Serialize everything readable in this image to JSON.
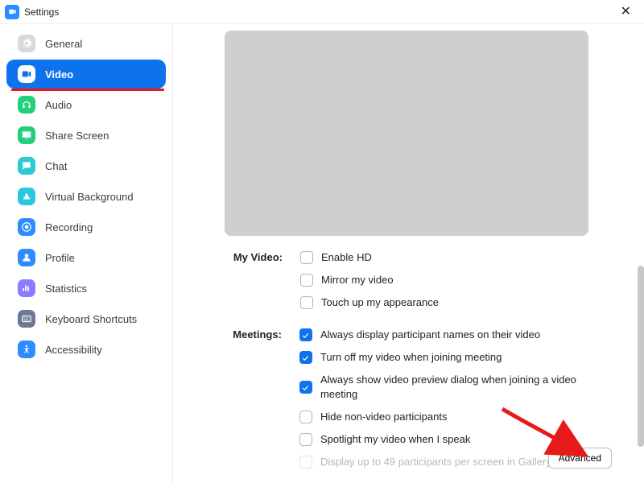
{
  "window": {
    "title": "Settings"
  },
  "sidebar": {
    "items": [
      {
        "label": "General"
      },
      {
        "label": "Video"
      },
      {
        "label": "Audio"
      },
      {
        "label": "Share Screen"
      },
      {
        "label": "Chat"
      },
      {
        "label": "Virtual Background"
      },
      {
        "label": "Recording"
      },
      {
        "label": "Profile"
      },
      {
        "label": "Statistics"
      },
      {
        "label": "Keyboard Shortcuts"
      },
      {
        "label": "Accessibility"
      }
    ]
  },
  "sections": {
    "my_video": {
      "title": "My Video:",
      "opts": [
        {
          "label": "Enable HD",
          "checked": false
        },
        {
          "label": "Mirror my video",
          "checked": false
        },
        {
          "label": "Touch up my appearance",
          "checked": false
        }
      ]
    },
    "meetings": {
      "title": "Meetings:",
      "opts": [
        {
          "label": "Always display participant names on their video",
          "checked": true
        },
        {
          "label": "Turn off my video when joining meeting",
          "checked": true
        },
        {
          "label": "Always show video preview dialog when joining a video meeting",
          "checked": true
        },
        {
          "label": "Hide non-video participants",
          "checked": false
        },
        {
          "label": "Spotlight my video when I speak",
          "checked": false
        },
        {
          "label": "Display up to 49 participants per screen in Gallery View",
          "checked": false,
          "disabled": true
        }
      ]
    }
  },
  "buttons": {
    "advanced": "Advanced"
  }
}
